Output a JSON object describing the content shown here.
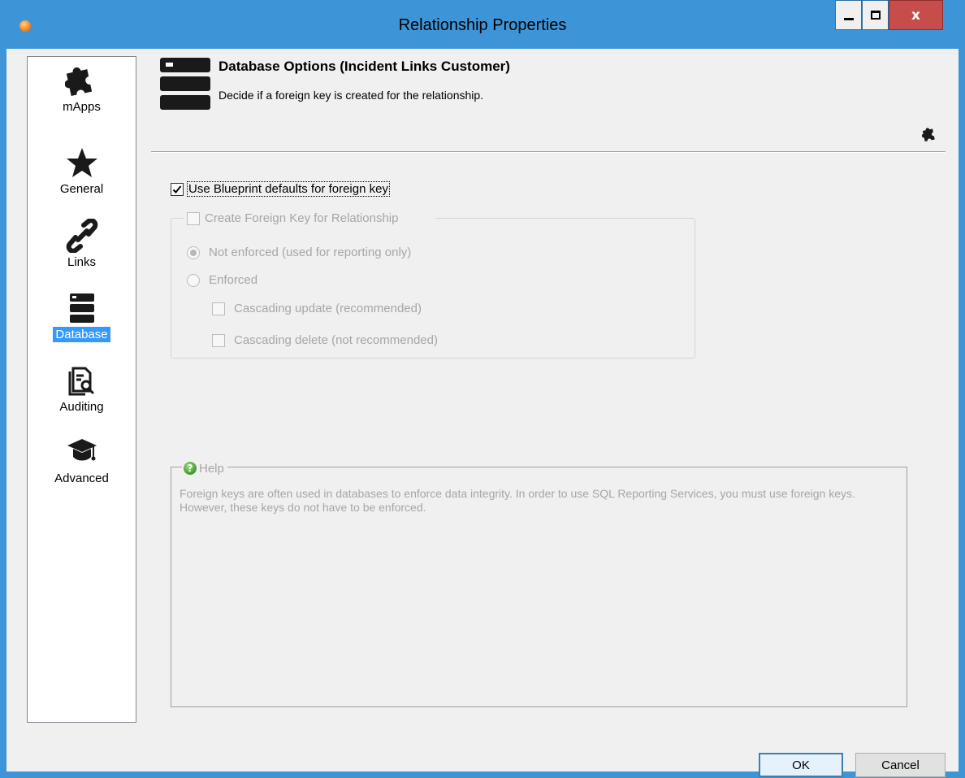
{
  "window": {
    "title": "Relationship Properties",
    "close_label": "x",
    "accent_color": "#3d95d8"
  },
  "sidebar": {
    "items": [
      {
        "label": "mApps",
        "icon": "puzzle-icon",
        "selected": false
      },
      {
        "label": "General",
        "icon": "star-icon",
        "selected": false
      },
      {
        "label": "Links",
        "icon": "link-icon",
        "selected": false
      },
      {
        "label": "Database",
        "icon": "database-icon",
        "selected": true
      },
      {
        "label": "Auditing",
        "icon": "audit-document-icon",
        "selected": false
      },
      {
        "label": "Advanced",
        "icon": "graduation-cap-icon",
        "selected": false
      }
    ]
  },
  "header": {
    "title": "Database Options  (Incident Links Customer)",
    "subtitle": "Decide if a foreign key is created for the relationship."
  },
  "options": {
    "use_blueprint_defaults": {
      "label": "Use Blueprint defaults for foreign key",
      "checked": true
    },
    "create_foreign_key": {
      "label": "Create Foreign Key for Relationship",
      "checked": false,
      "enabled": false
    },
    "not_enforced": {
      "label": "Not enforced (used for reporting only)",
      "selected": true,
      "enabled": false
    },
    "enforced": {
      "label": "Enforced",
      "selected": false,
      "enabled": false
    },
    "cascading_update": {
      "label": "Cascading update (recommended)",
      "checked": false,
      "enabled": false
    },
    "cascading_delete": {
      "label": "Cascading delete (not recommended)",
      "checked": false,
      "enabled": false
    }
  },
  "help": {
    "title": "Help",
    "text": "Foreign keys are often used in databases to enforce data integrity.  In order to use SQL Reporting Services, you must use foreign keys.  However, these keys do not have to be enforced."
  },
  "buttons": {
    "ok": "OK",
    "cancel": "Cancel"
  }
}
